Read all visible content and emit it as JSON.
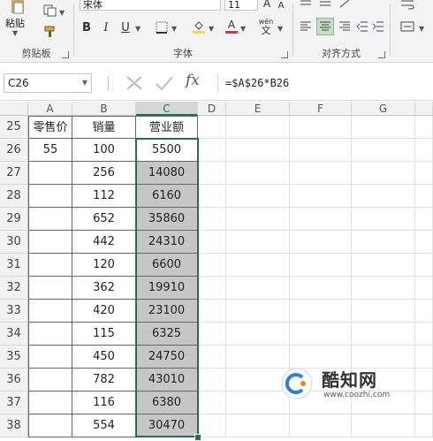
{
  "ribbon": {
    "clipboard": {
      "paste_label": "粘贴",
      "group_label": "剪贴板"
    },
    "font": {
      "font_name": "宋体",
      "font_size": "11",
      "bold": "B",
      "italic": "I",
      "underline": "U",
      "text_color_label": "A",
      "grow_font": "A",
      "shrink_font": "A",
      "phonetic_label": "wén",
      "phonetic_glyph": "文",
      "group_label": "字体"
    },
    "alignment": {
      "group_label": "对齐方式"
    },
    "colors": {
      "font_color_bar": "#e03030",
      "fill_color_bar": "#ffe000",
      "accent": "#217346"
    }
  },
  "formula_bar": {
    "name_box": "C26",
    "formula": "=$A$26*B26",
    "fx_label": "fx"
  },
  "columns": [
    "A",
    "B",
    "C",
    "D",
    "E",
    "F",
    "G"
  ],
  "selected_column": "C",
  "rows": [
    {
      "row": "25",
      "a": "零售价",
      "b": "销量",
      "c": "营业额"
    },
    {
      "row": "26",
      "a": "55",
      "b": "100",
      "c": "5500"
    },
    {
      "row": "27",
      "a": "",
      "b": "256",
      "c": "14080"
    },
    {
      "row": "28",
      "a": "",
      "b": "112",
      "c": "6160"
    },
    {
      "row": "29",
      "a": "",
      "b": "652",
      "c": "35860"
    },
    {
      "row": "30",
      "a": "",
      "b": "442",
      "c": "24310"
    },
    {
      "row": "31",
      "a": "",
      "b": "120",
      "c": "6600"
    },
    {
      "row": "32",
      "a": "",
      "b": "362",
      "c": "19910"
    },
    {
      "row": "33",
      "a": "",
      "b": "420",
      "c": "23100"
    },
    {
      "row": "34",
      "a": "",
      "b": "115",
      "c": "6325"
    },
    {
      "row": "35",
      "a": "",
      "b": "450",
      "c": "24750"
    },
    {
      "row": "36",
      "a": "",
      "b": "782",
      "c": "43010"
    },
    {
      "row": "37",
      "a": "",
      "b": "116",
      "c": "6380"
    },
    {
      "row": "38",
      "a": "",
      "b": "554",
      "c": "30470"
    }
  ],
  "watermark": {
    "name": "酷知网",
    "url": "www.coozhi.com",
    "logo_text": "C"
  }
}
